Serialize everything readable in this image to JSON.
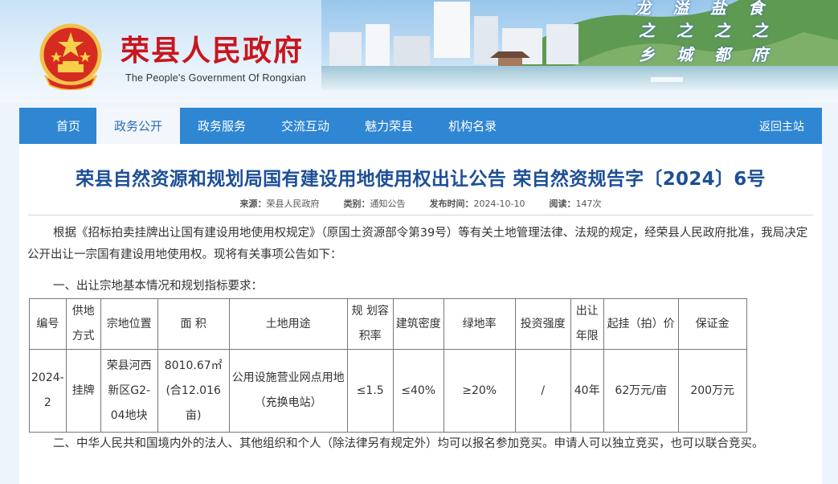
{
  "header": {
    "site_title": "荣县人民政府",
    "site_subtitle": "The People's Government Of Rongxian",
    "slogan_1": "龙   溢   盐   食",
    "slogan_2": "之   之   之   之",
    "slogan_3": "乡   城   都   府"
  },
  "nav": {
    "items": [
      {
        "label": "首页"
      },
      {
        "label": "政务公开"
      },
      {
        "label": "政务服务"
      },
      {
        "label": "交流互动"
      },
      {
        "label": "魅力荣县"
      },
      {
        "label": "机构名录"
      }
    ],
    "back_label": "返回主站"
  },
  "article": {
    "title": "荣县自然资源和规划局国有建设用地使用权出让公告 荣自然资规告字〔2024〕6号",
    "meta": {
      "source_label": "来源：",
      "source_value": "荣县人民政府",
      "category_label": "类别：",
      "category_value": "通知公告",
      "date_label": "发布时间：",
      "date_value": "2024-10-10",
      "views_label": "阅读：",
      "views_value": "147次"
    },
    "p1": "根据《招标拍卖挂牌出让国有建设用地使用权规定》（原国土资源部令第39号）等有关土地管理法律、法规的规定，经荣县人民政府批准，我局决定公开出让一宗国有建设用地使用权。现将有关事项公告如下：",
    "p2": "一、出让宗地基本情况和规划指标要求：",
    "p3": "二、中华人民共和国境内外的法人、其他组织和个人（除法律另有规定外）均可以报名参加竞买。申请人可以独立竞买，也可以联合竞买。"
  },
  "table": {
    "headers": [
      "编号",
      "供地方式",
      "宗地位置",
      "面 积",
      "土地用途",
      "规 划容积率",
      "建筑密度",
      "绿地率",
      "投资强度",
      "出让年限",
      "起挂（拍）价",
      "保证金"
    ],
    "row": [
      "2024-2",
      "挂牌",
      "荣县河西新区G2-04地块",
      "8010.67㎡(合12.016亩)",
      "公用设施营业网点用地（充换电站）",
      "≤1.5",
      "≤40%",
      "≥20%",
      "/",
      "40年",
      "62万元/亩",
      "200万元"
    ]
  }
}
